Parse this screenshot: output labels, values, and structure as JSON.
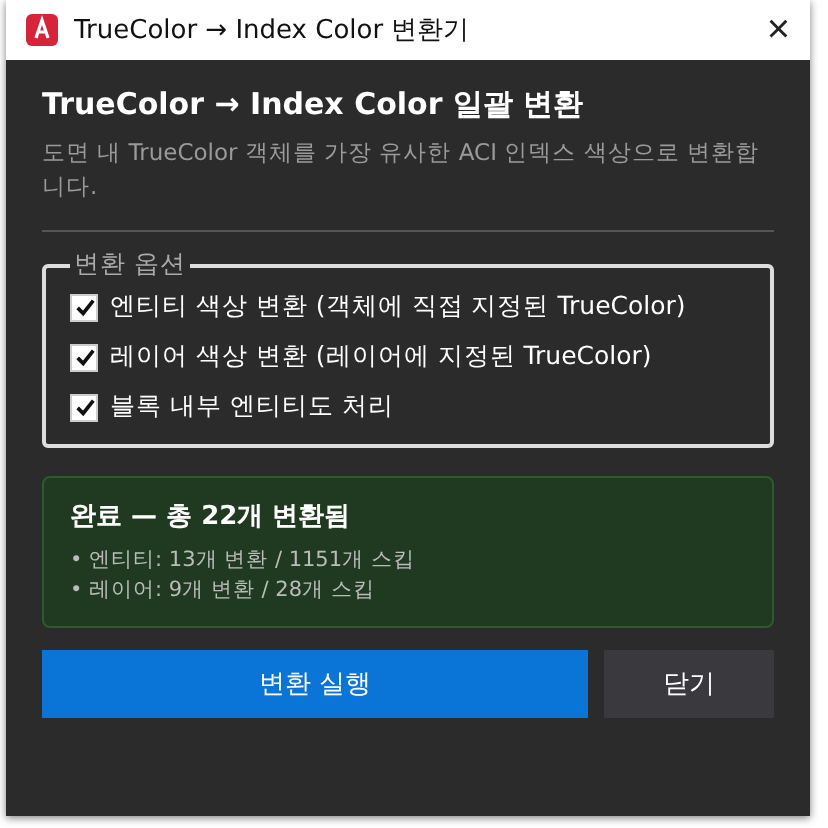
{
  "window": {
    "title": "TrueColor → Index Color 변환기",
    "close": "×"
  },
  "heading": "TrueColor → Index Color 일괄 변환",
  "description": "도면 내 TrueColor 객체를 가장 유사한 ACI 인덱스 색상으로 변환합니다.",
  "options": {
    "legend": "변환 옵션",
    "items": [
      {
        "label": "엔티티 색상 변환 (객체에 직접 지정된 TrueColor)",
        "checked": true
      },
      {
        "label": "레이어 색상 변환 (레이어에 지정된 TrueColor)",
        "checked": true
      },
      {
        "label": "블록 내부 엔티티도 처리",
        "checked": true
      }
    ]
  },
  "result": {
    "title": "완료 — 총 22개 변환됨",
    "lines": [
      "• 엔티티: 13개 변환 / 1151개 스킵",
      "• 레이어: 9개 변환 / 28개 스킵"
    ]
  },
  "buttons": [
    {
      "label": "변환 실행",
      "kind": "primary"
    },
    {
      "label": "닫기",
      "kind": "secondary"
    }
  ]
}
